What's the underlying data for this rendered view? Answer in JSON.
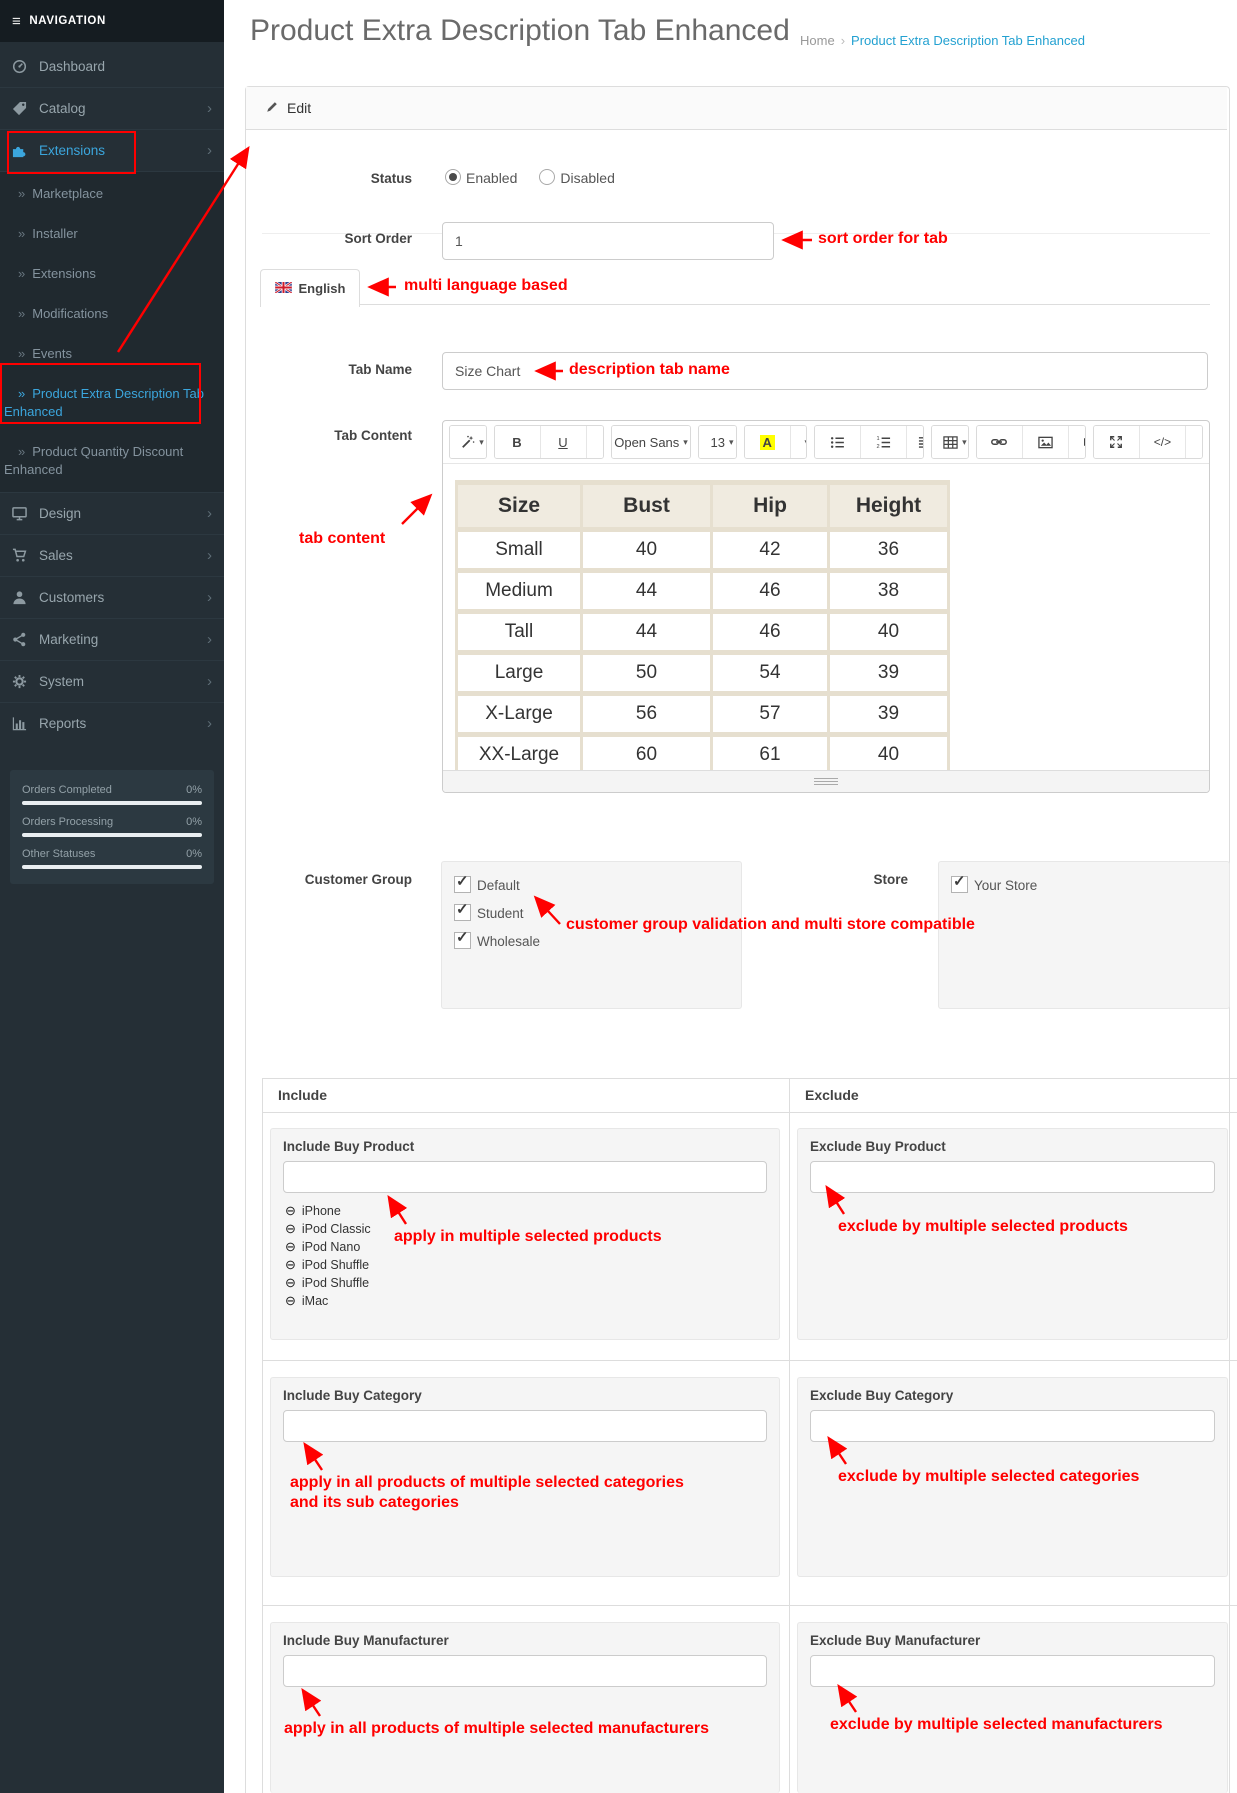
{
  "icons": {
    "hamburger": "≡",
    "chevron_right": "›",
    "double_arrow": "»",
    "minus_circle": "⊖",
    "check": "✓",
    "caret_down": "▾",
    "breadcrumb_sep": "›"
  },
  "sidebar": {
    "header": "NAVIGATION",
    "items": {
      "dashboard": "Dashboard",
      "catalog": "Catalog",
      "extensions": "Extensions",
      "marketplace": "Marketplace",
      "installer": "Installer",
      "extensions_sub": "Extensions",
      "modifications": "Modifications",
      "events": "Events",
      "pedt": "Product Extra Description Tab Enhanced",
      "pqd": "Product Quantity Discount Enhanced",
      "design": "Design",
      "sales": "Sales",
      "customers": "Customers",
      "marketing": "Marketing",
      "system": "System",
      "reports": "Reports"
    },
    "stats": {
      "completed": {
        "label": "Orders Completed",
        "value": "0%"
      },
      "processing": {
        "label": "Orders Processing",
        "value": "0%"
      },
      "other": {
        "label": "Other Statuses",
        "value": "0%"
      }
    }
  },
  "header": {
    "title": "Product Extra Description Tab Enhanced",
    "breadcrumb_home": "Home",
    "breadcrumb_current": "Product Extra Description Tab Enhanced"
  },
  "panel": {
    "heading": "Edit"
  },
  "form": {
    "status_label": "Status",
    "status_enabled": "Enabled",
    "status_disabled": "Disabled",
    "sort_order_label": "Sort Order",
    "sort_order_value": "1",
    "language_tab": "English",
    "tab_name_label": "Tab Name",
    "tab_name_value": "Size Chart",
    "tab_content_label": "Tab Content",
    "customer_group_label": "Customer Group",
    "customer_groups": [
      "Default",
      "Student",
      "Wholesale"
    ],
    "store_label": "Store",
    "store_value": "Your Store"
  },
  "editor": {
    "bold_label": "B",
    "underline_label": "U",
    "font_name": "Open Sans",
    "font_size": "13",
    "color_letter": "A",
    "code_label": "</>",
    "help_label": "?"
  },
  "size_chart": {
    "headers": [
      "Size",
      "Bust",
      "Hip",
      "Height"
    ],
    "rows": [
      [
        "Small",
        "40",
        "42",
        "36"
      ],
      [
        "Medium",
        "44",
        "46",
        "38"
      ],
      [
        "Tall",
        "44",
        "46",
        "40"
      ],
      [
        "Large",
        "50",
        "54",
        "39"
      ],
      [
        "X-Large",
        "56",
        "57",
        "39"
      ],
      [
        "XX-Large",
        "60",
        "61",
        "40"
      ]
    ]
  },
  "include_exclude": {
    "include_header": "Include",
    "exclude_header": "Exclude",
    "include_product_label": "Include Buy Product",
    "exclude_product_label": "Exclude Buy Product",
    "include_category_label": "Include Buy Category",
    "exclude_category_label": "Exclude Buy Category",
    "include_manufacturer_label": "Include Buy Manufacturer",
    "exclude_manufacturer_label": "Exclude Buy Manufacturer",
    "products": [
      "iPhone",
      "iPod Classic",
      "iPod Nano",
      "iPod Shuffle",
      "iPod Shuffle",
      "iMac"
    ]
  },
  "annotations": {
    "sort_order": "sort order for tab",
    "language": "multi language based",
    "tab_name": "description tab name",
    "tab_content": "tab content",
    "customer_group": "customer group validation and multi store compatible",
    "include_product": "apply in multiple selected products",
    "exclude_product": "exclude by multiple selected products",
    "include_category_1": "apply in all products of multiple selected categories",
    "include_category_2": "and its sub categories",
    "exclude_category": "exclude by multiple selected categories",
    "include_manufacturer": "apply in all products of multiple selected manufacturers",
    "exclude_manufacturer": "exclude by multiple selected manufacturers"
  },
  "colors": {
    "annotation_red": "#ff0000",
    "link_blue": "#23a1d1",
    "sidebar_active_blue": "#3ba6dd"
  }
}
